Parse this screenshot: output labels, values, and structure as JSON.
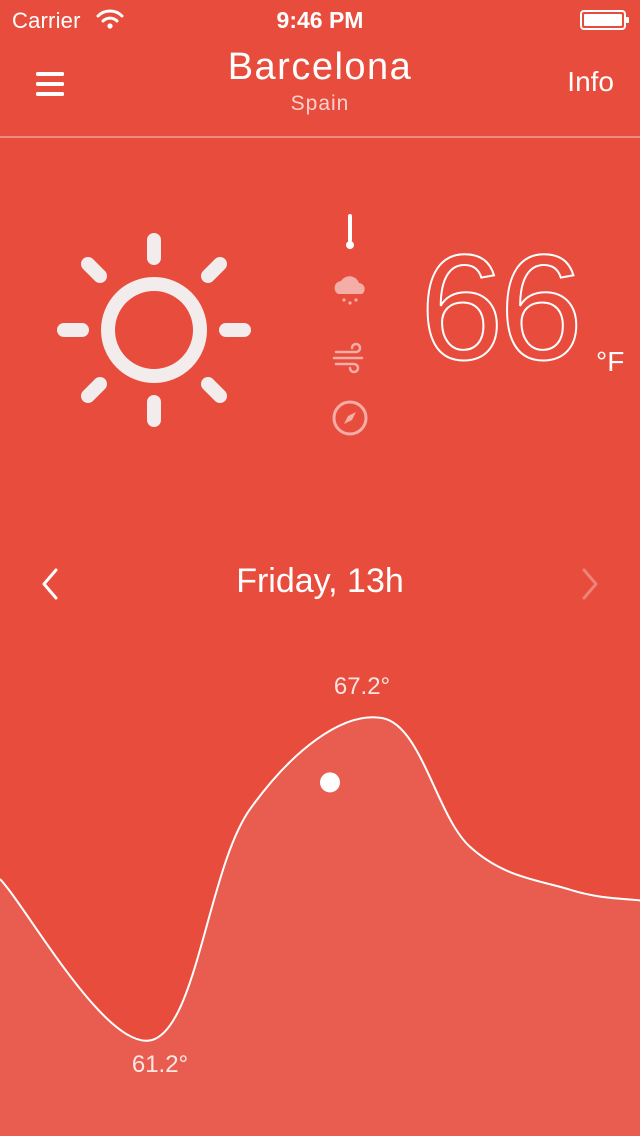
{
  "status_bar": {
    "carrier": "Carrier",
    "time": "9:46 PM",
    "icons": [
      "wifi-icon",
      "battery-icon"
    ]
  },
  "nav": {
    "city": "Barcelona",
    "country": "Spain",
    "info_label": "Info",
    "menu_icon": "hamburger-menu-icon"
  },
  "weather": {
    "condition_icon": "sun-icon",
    "temperature": "66",
    "unit": "°F",
    "metric_icons": [
      "thermometer-icon",
      "rain-cloud-icon",
      "wind-icon",
      "compass-icon"
    ]
  },
  "day_selector": {
    "label": "Friday, 13h",
    "prev_icon": "chevron-left-icon",
    "next_icon": "chevron-right-icon"
  },
  "colors": {
    "background": "#e84c3d",
    "chart_fill": "#e85d4f",
    "foreground": "#ffffff"
  },
  "chart_data": {
    "type": "area",
    "y_unit": "°",
    "y": [
      64.2,
      61.2,
      65.5,
      67.2,
      64.8,
      64.0,
      63.8
    ],
    "max_label": "67.2°",
    "min_label": "61.2°",
    "selected_value": 66
  }
}
